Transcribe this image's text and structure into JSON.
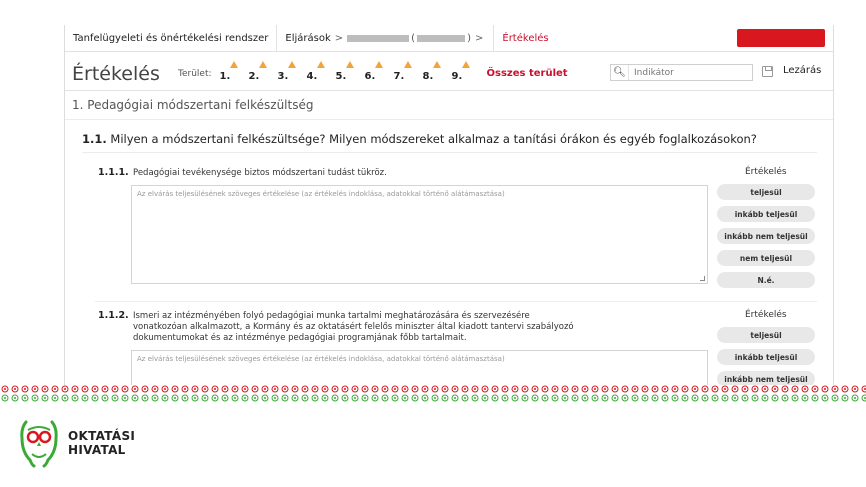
{
  "breadcrumb": {
    "root": "Tanfelügyeleti és önértékelési rendszer",
    "procedures": "Eljárások",
    "separator": ">",
    "open_paren": "(",
    "close_paren": ")",
    "current": "Értékelés"
  },
  "header": {
    "title": "Értékelés",
    "area_label": "Terület:",
    "areas": [
      "1.",
      "2.",
      "3.",
      "4.",
      "5.",
      "6.",
      "7.",
      "8.",
      "9."
    ],
    "all_areas": "Összes terület",
    "search_placeholder": "Indikátor",
    "close_label": "Lezárás"
  },
  "section": {
    "title": "1. Pedagógiai módszertani felkészültség"
  },
  "question": {
    "number": "1.1.",
    "text": "Milyen a módszertani felkészültsége? Milyen módszereket alkalmaz a tanítási órákon és egyéb foglalkozásokon?"
  },
  "criteria": [
    {
      "number": "1.1.1.",
      "text": "Pedagógiai tevékenysége biztos módszertani tudást tükröz.",
      "placeholder": "Az elvárás teljesülésének szöveges értékelése (az értékelés indoklása, adatokkal történő alátámasztása)",
      "eval_label": "Értékelés",
      "options": [
        "teljesül",
        "inkább teljesül",
        "inkább nem teljesül",
        "nem teljesül",
        "N.é."
      ]
    },
    {
      "number": "1.1.2.",
      "text_lines": [
        "Ismeri az intézményében folyó pedagógiai munka tartalmi meghatározására és szervezésére",
        "vonatkozóan alkalmazott, a Kormány és az oktatásért felelős miniszter által kiadott tantervi szabályozó",
        "dokumentumokat és az intézménye pedagógiai programjának főbb tartalmait."
      ],
      "placeholder": "Az elvárás teljesülésének szöveges értékelése (az értékelés indoklása, adatokkal történő alátámasztása)",
      "eval_label": "Értékelés",
      "options": [
        "teljesül",
        "inkább teljesül",
        "inkább nem teljesül"
      ]
    }
  ],
  "footer": {
    "logo_line1": "OKTATÁSI",
    "logo_line2": "HIVATAL"
  },
  "colors": {
    "accent_red": "#c8102e",
    "warning": "#f2a33a",
    "logo_green": "#3aaa35",
    "logo_red": "#d8171e"
  }
}
